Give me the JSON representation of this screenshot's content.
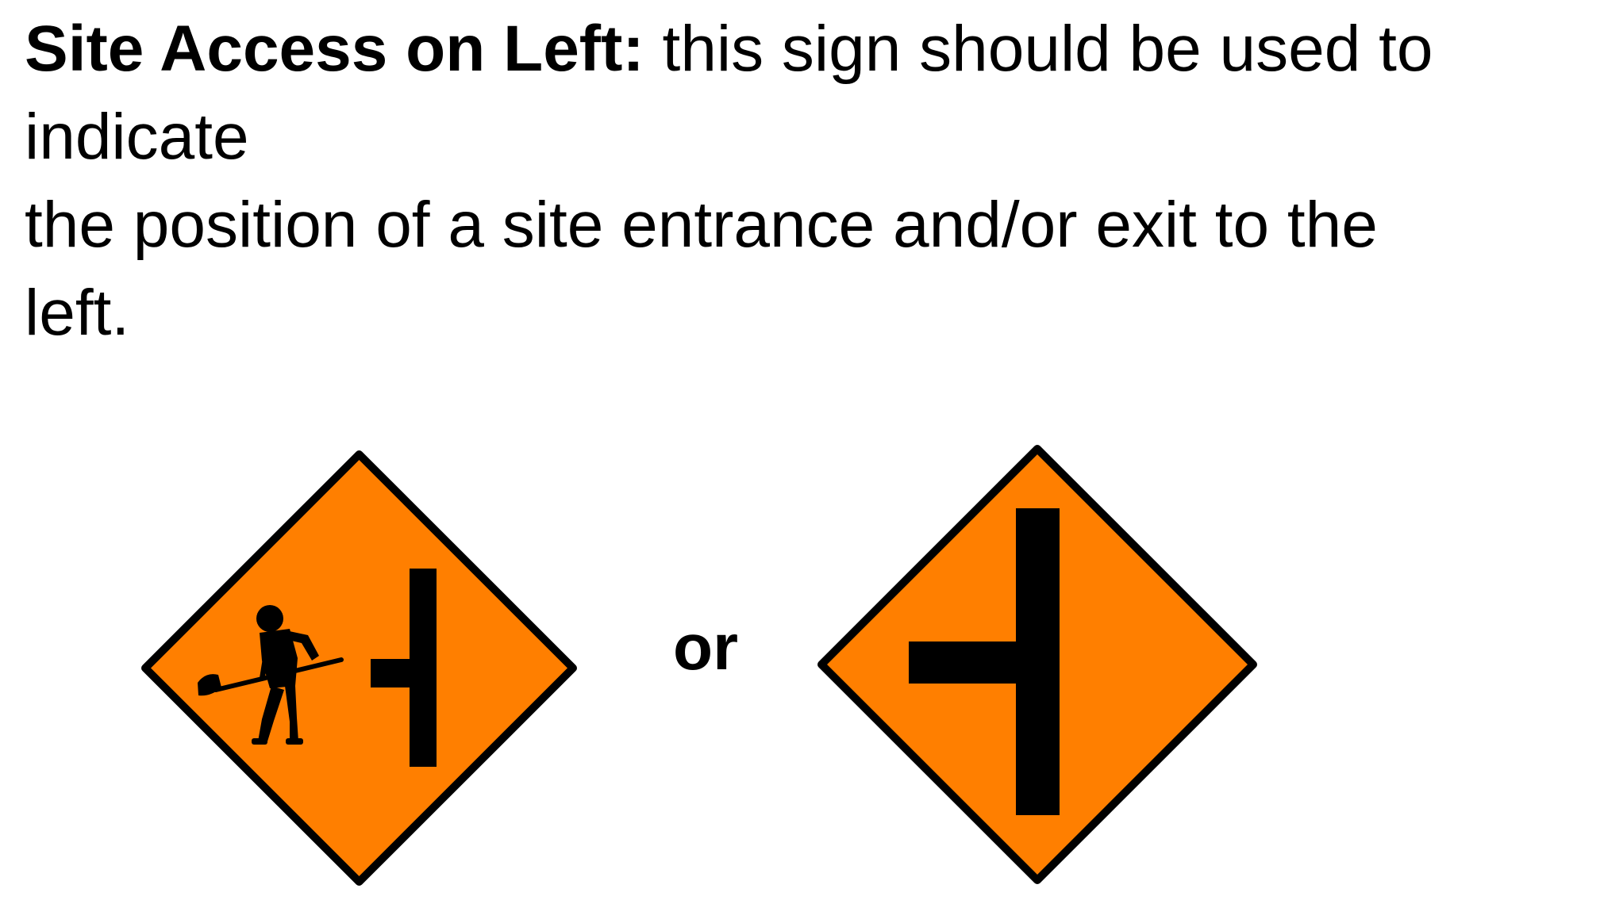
{
  "description": {
    "heading": "Site Access on Left:",
    "line_1_rest": "this sign should be used to",
    "line_2": "indicate",
    "line_3": "the position of a site entrance and/or exit to the",
    "line_4": "left."
  },
  "separator": "or",
  "signs": [
    {
      "icon": "roadworks-side-road-left-sign-icon",
      "depicts": "worker with shovel and side road joining from the left"
    },
    {
      "icon": "side-road-left-sign-icon",
      "depicts": "side road joining from the left"
    }
  ],
  "colors": {
    "sign_fill": "#FF7F00",
    "sign_border": "#000000",
    "symbol": "#000000",
    "text": "#000000",
    "background": "#FFFFFF"
  }
}
